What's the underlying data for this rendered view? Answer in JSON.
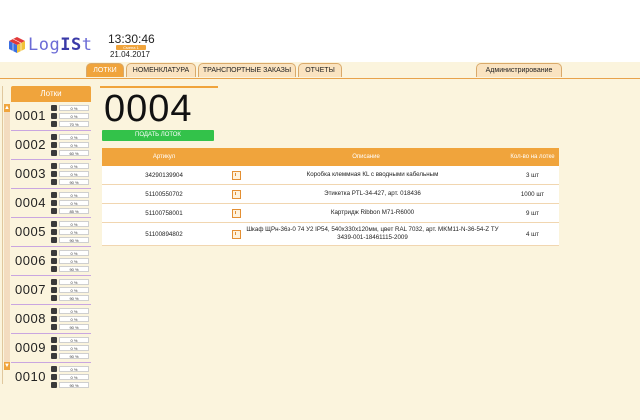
{
  "header": {
    "logo_part1": "Log",
    "logo_part2": "IS",
    "logo_part3": "t",
    "time": "13:30:46",
    "shift_label": "Смена 1",
    "date": "21.04.2017"
  },
  "tabs": [
    {
      "label": "ЛОТКИ",
      "active": true
    },
    {
      "label": "НОМЕНКЛАТУРА",
      "active": false
    },
    {
      "label": "ТРАНСПОРТНЫЕ ЗАКАЗЫ",
      "active": false
    },
    {
      "label": "ОТЧЕТЫ",
      "active": false
    },
    {
      "label": "Администрирование",
      "active": false
    }
  ],
  "sidebar": {
    "title": "Лотки",
    "lots": [
      {
        "num": "0001",
        "s": [
          "0 %",
          "0 %",
          "70 %"
        ]
      },
      {
        "num": "0002",
        "s": [
          "0 %",
          "0 %",
          "60 %"
        ]
      },
      {
        "num": "0003",
        "s": [
          "0 %",
          "0 %",
          "90 %"
        ]
      },
      {
        "num": "0004",
        "s": [
          "0 %",
          "0 %",
          "85 %"
        ]
      },
      {
        "num": "0005",
        "s": [
          "0 %",
          "0 %",
          "90 %"
        ]
      },
      {
        "num": "0006",
        "s": [
          "0 %",
          "0 %",
          "90 %"
        ]
      },
      {
        "num": "0007",
        "s": [
          "0 %",
          "0 %",
          "90 %"
        ]
      },
      {
        "num": "0008",
        "s": [
          "0 %",
          "0 %",
          "90 %"
        ]
      },
      {
        "num": "0009",
        "s": [
          "0 %",
          "0 %",
          "90 %"
        ]
      },
      {
        "num": "0010",
        "s": [
          "0 %",
          "0 %",
          "90 %"
        ]
      }
    ]
  },
  "main": {
    "lot_number": "0004",
    "submit_label": "ПОДАТЬ ЛОТОК",
    "table": {
      "headers": [
        "Артикул",
        "Описание",
        "Кол-во на лотке"
      ],
      "rows": [
        {
          "article": "34290139904",
          "desc": "Коробка клеммная КL с вводными кабельным",
          "qty": "3 шт"
        },
        {
          "article": "51100550702",
          "desc": "Этикетка PTL-34-427, арт. 018436",
          "qty": "1000 шт"
        },
        {
          "article": "51100758001",
          "desc": "Картридж Ribbon M71-R6000",
          "qty": "9 шт"
        },
        {
          "article": "51100894802",
          "desc": "Шкаф ЩРн-36з-0 74 У2 IP54, 540х330х120мм, цвет RAL 7032, арт. MKM11-N-36-54-Z ТУ 3439-001-18461115-2009",
          "qty": "4 шт"
        }
      ]
    }
  }
}
